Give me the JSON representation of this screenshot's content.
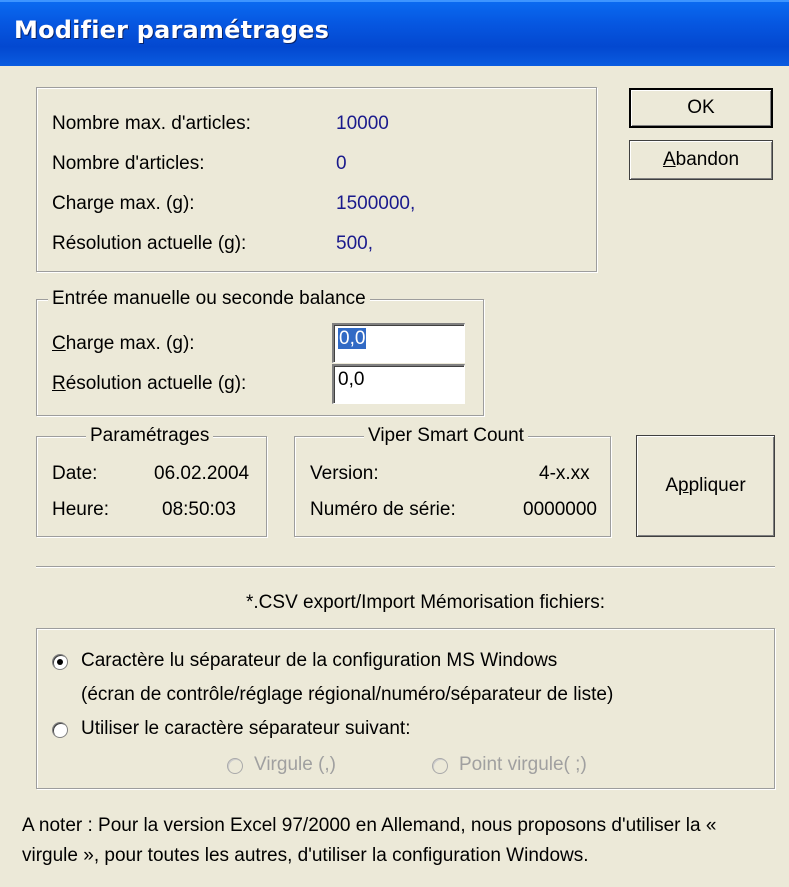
{
  "window": {
    "title": "Modifier paramétrages"
  },
  "info": {
    "max_articles_label": "Nombre max. d'articles:",
    "max_articles_value": "10000",
    "articles_label": "Nombre d'articles:",
    "articles_value": "0",
    "max_load_label": "Charge max. (g):",
    "max_load_value": "1500000,",
    "resolution_label": "Résolution actuelle (g):",
    "resolution_value": "500,"
  },
  "buttons": {
    "ok": "OK",
    "cancel_prefix": "",
    "cancel_u": "A",
    "cancel_rest": "bandon",
    "apply_prefix": "A",
    "apply_u": "p",
    "apply_rest": "pliquer"
  },
  "manual": {
    "legend": "Entrée manuelle ou seconde balance",
    "charge_u": "C",
    "charge_rest": "harge max. (g):",
    "charge_value": "0,0",
    "res_u": "R",
    "res_rest": "ésolution actuelle (g):",
    "res_value": "0,0"
  },
  "settings": {
    "legend": "Paramétrages",
    "date_label": "Date:",
    "date_value": "06.02.2004",
    "time_label": "Heure:",
    "time_value": "08:50:03"
  },
  "viper": {
    "legend": "Viper Smart Count",
    "version_label": "Version:",
    "version_value": "4-x.xx",
    "serial_label": "Numéro de série:",
    "serial_value": "0000000"
  },
  "csv": {
    "heading": "*.CSV export/Import Mémorisation fichiers:",
    "option1_line1": "Caractère lu séparateur de la configuration MS Windows",
    "option1_line2": "(écran de contrôle/réglage régional/numéro/séparateur de liste)",
    "option2": "Utiliser le caractère séparateur suivant:",
    "sub_comma": "Virgule (,)",
    "sub_semicolon": "Point virgule( ;)",
    "selected": "option1"
  },
  "note": {
    "line1": "A noter : Pour la version Excel 97/2000 en Allemand, nous proposons d'utiliser la «",
    "line2": "virgule », pour toutes les autres, d'utiliser la configuration Windows."
  }
}
